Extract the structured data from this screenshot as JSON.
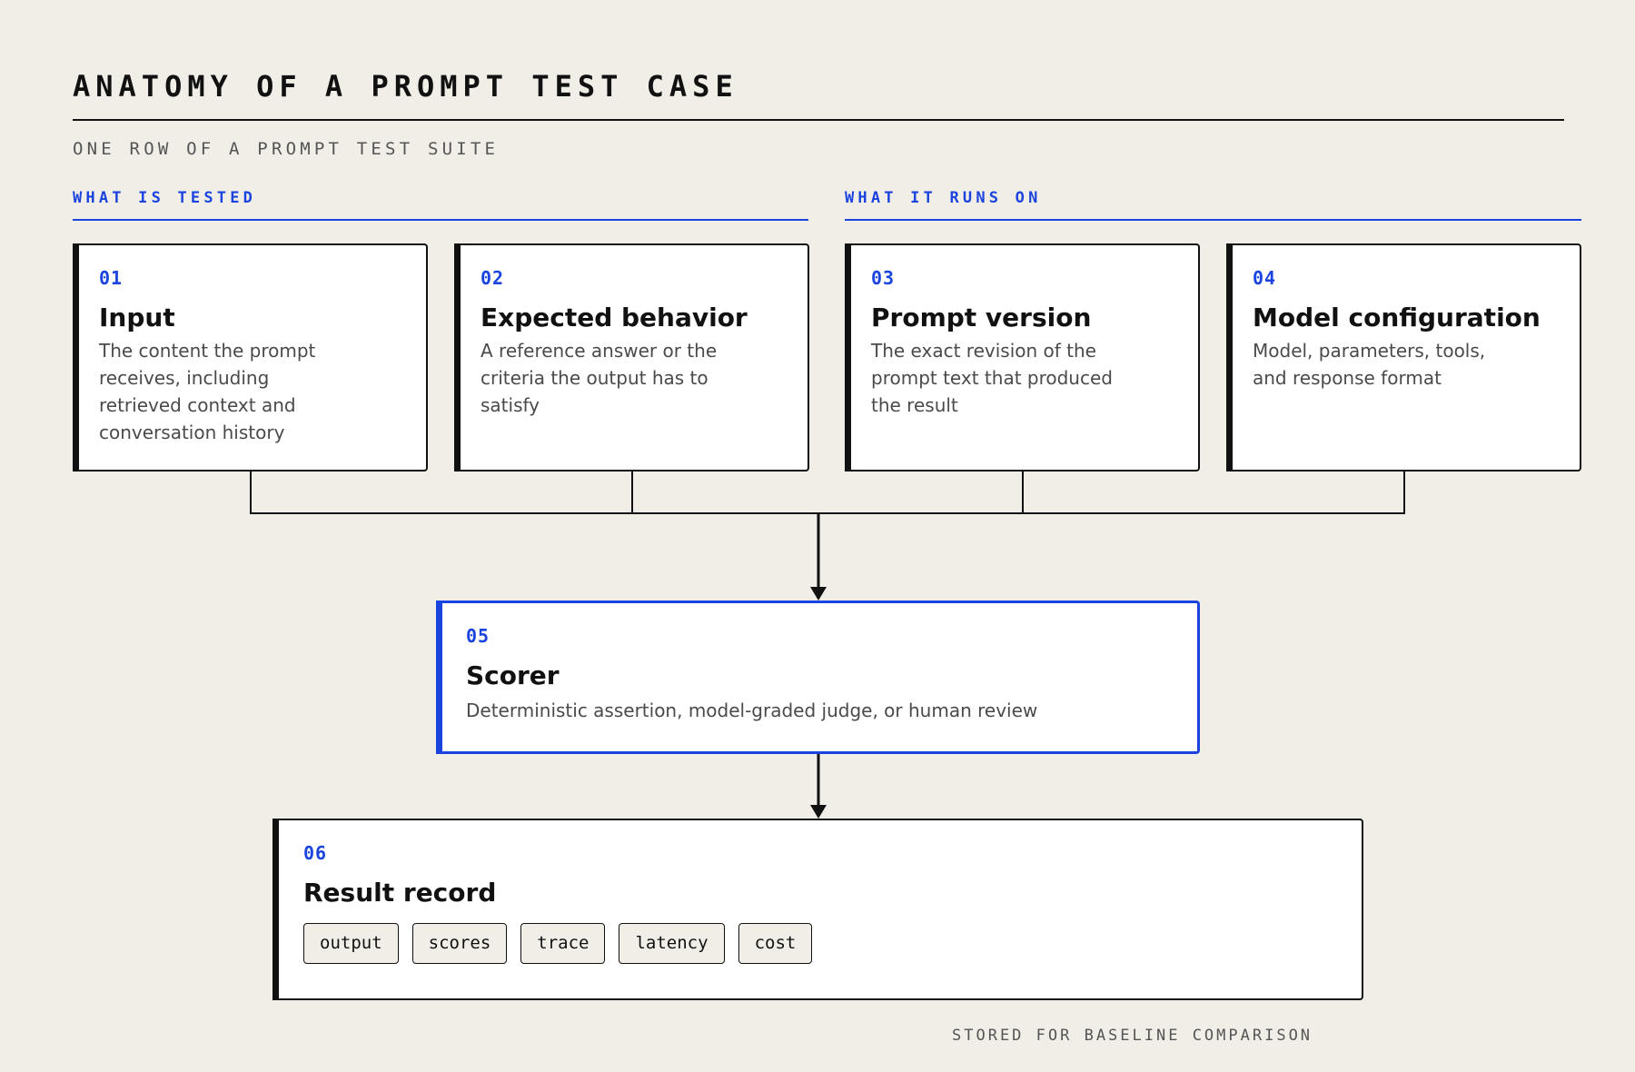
{
  "header": {
    "title": "ANATOMY OF A PROMPT TEST CASE",
    "subtitle": "ONE ROW OF A PROMPT TEST SUITE"
  },
  "sections": {
    "tested": "WHAT IS TESTED",
    "runs_on": "WHAT IT RUNS ON"
  },
  "cards": [
    {
      "num": "01",
      "title": "Input",
      "desc": "The content the prompt receives, including retrieved context and conversation history"
    },
    {
      "num": "02",
      "title": "Expected behavior",
      "desc": "A reference answer or the criteria the output has to satisfy"
    },
    {
      "num": "03",
      "title": "Prompt version",
      "desc": "The exact revision of the prompt text that produced the result"
    },
    {
      "num": "04",
      "title": "Model configuration",
      "desc": "Model, parameters, tools, and response format"
    }
  ],
  "scorer": {
    "num": "05",
    "title": "Scorer",
    "desc": "Deterministic assertion, model-graded judge, or human review"
  },
  "result": {
    "num": "06",
    "title": "Result record",
    "chips": [
      "output",
      "scores",
      "trace",
      "latency",
      "cost"
    ]
  },
  "footer": "STORED FOR BASELINE COMPARISON",
  "colors": {
    "accent": "#1a44dd",
    "background": "#f1eee8",
    "ink": "#111111"
  }
}
